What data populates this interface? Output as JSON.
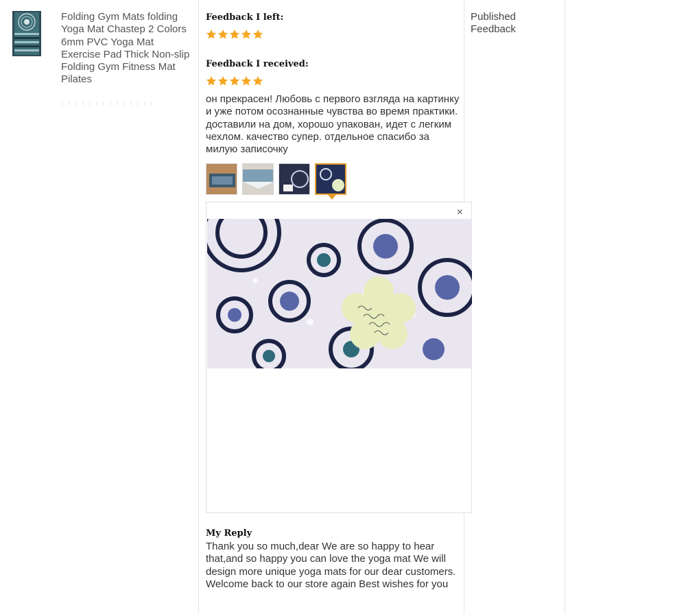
{
  "product": {
    "title": "Folding Gym Mats folding Yoga Mat Chastep 2 Colors 6mm PVC Yoga Mat Exercise Pad Thick Non-slip Folding Gym Fitness Mat Pilates",
    "thumbnail_icon": "yoga-mat-image"
  },
  "feedback": {
    "left_label": "Feedback I left:",
    "left_rating": 5,
    "received_label": "Feedback I received:",
    "received_rating": 5,
    "star_color": "#f5a623",
    "review_text": "он прекрасен! Любовь с первого взгляда на картинку и уже потом осознанные чувства во время практики. доставили на дом, хорошо упакован, идет с легким чехлом. качество супер. отдельное спасибо за милую записочку",
    "photos": [
      "photo-1",
      "photo-2",
      "photo-3",
      "photo-4"
    ],
    "selected_photo": 4,
    "selected_color": "#e59d29",
    "viewer_close": "×",
    "reply_label": "My Reply",
    "reply_text": "Thank you so much,dear We are so happy to hear that,and so happy you can love the yoga mat We will design more unique yoga mats for our dear customers. Welcome back to our store again Best wishes for you"
  },
  "status": {
    "text": "Published Feedback"
  }
}
